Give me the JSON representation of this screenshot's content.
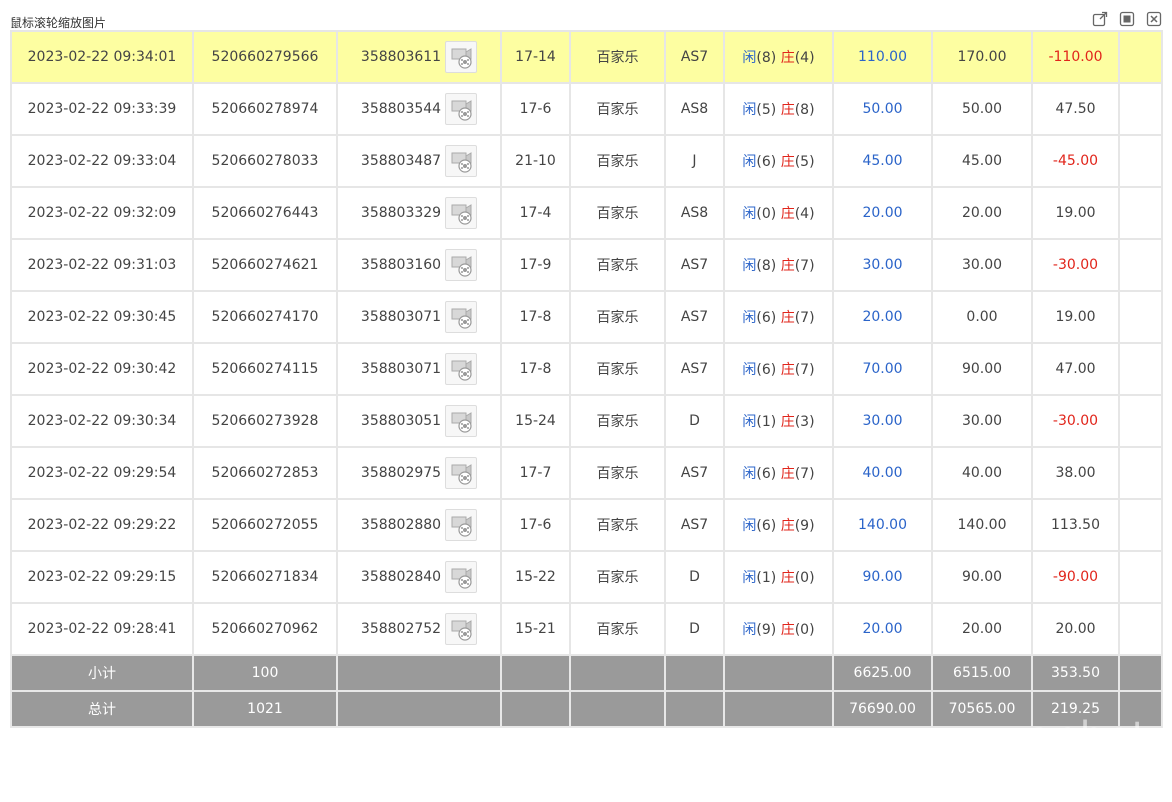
{
  "window": {
    "title": "鼠标滚轮缩放图片",
    "icons": [
      "external-link-icon",
      "maximize-icon",
      "close-icon"
    ]
  },
  "rows": [
    {
      "time": "2023-02-22 09:34:01",
      "order": "520660279566",
      "game": "358803611",
      "table": "17-14",
      "type": "百家乐",
      "dealer": "AS7",
      "player_label": "闲",
      "player": "(8)",
      "banker_label": "庄",
      "banker": "(4)",
      "bet": "110.00",
      "valid": "170.00",
      "result": "-110.00",
      "result_neg": true,
      "highlight": true
    },
    {
      "time": "2023-02-22 09:33:39",
      "order": "520660278974",
      "game": "358803544",
      "table": "17-6",
      "type": "百家乐",
      "dealer": "AS8",
      "player_label": "闲",
      "player": "(5)",
      "banker_label": "庄",
      "banker": "(8)",
      "bet": "50.00",
      "valid": "50.00",
      "result": "47.50",
      "result_neg": false
    },
    {
      "time": "2023-02-22 09:33:04",
      "order": "520660278033",
      "game": "358803487",
      "table": "21-10",
      "type": "百家乐",
      "dealer": "J",
      "player_label": "闲",
      "player": "(6)",
      "banker_label": "庄",
      "banker": "(5)",
      "bet": "45.00",
      "valid": "45.00",
      "result": "-45.00",
      "result_neg": true
    },
    {
      "time": "2023-02-22 09:32:09",
      "order": "520660276443",
      "game": "358803329",
      "table": "17-4",
      "type": "百家乐",
      "dealer": "AS8",
      "player_label": "闲",
      "player": "(0)",
      "banker_label": "庄",
      "banker": "(4)",
      "bet": "20.00",
      "valid": "20.00",
      "result": "19.00",
      "result_neg": false
    },
    {
      "time": "2023-02-22 09:31:03",
      "order": "520660274621",
      "game": "358803160",
      "table": "17-9",
      "type": "百家乐",
      "dealer": "AS7",
      "player_label": "闲",
      "player": "(8)",
      "banker_label": "庄",
      "banker": "(7)",
      "bet": "30.00",
      "valid": "30.00",
      "result": "-30.00",
      "result_neg": true
    },
    {
      "time": "2023-02-22 09:30:45",
      "order": "520660274170",
      "game": "358803071",
      "table": "17-8",
      "type": "百家乐",
      "dealer": "AS7",
      "player_label": "闲",
      "player": "(6)",
      "banker_label": "庄",
      "banker": "(7)",
      "bet": "20.00",
      "valid": "0.00",
      "result": "19.00",
      "result_neg": false
    },
    {
      "time": "2023-02-22 09:30:42",
      "order": "520660274115",
      "game": "358803071",
      "table": "17-8",
      "type": "百家乐",
      "dealer": "AS7",
      "player_label": "闲",
      "player": "(6)",
      "banker_label": "庄",
      "banker": "(7)",
      "bet": "70.00",
      "valid": "90.00",
      "result": "47.00",
      "result_neg": false
    },
    {
      "time": "2023-02-22 09:30:34",
      "order": "520660273928",
      "game": "358803051",
      "table": "15-24",
      "type": "百家乐",
      "dealer": "D",
      "player_label": "闲",
      "player": "(1)",
      "banker_label": "庄",
      "banker": "(3)",
      "bet": "30.00",
      "valid": "30.00",
      "result": "-30.00",
      "result_neg": true
    },
    {
      "time": "2023-02-22 09:29:54",
      "order": "520660272853",
      "game": "358802975",
      "table": "17-7",
      "type": "百家乐",
      "dealer": "AS7",
      "player_label": "闲",
      "player": "(6)",
      "banker_label": "庄",
      "banker": "(7)",
      "bet": "40.00",
      "valid": "40.00",
      "result": "38.00",
      "result_neg": false
    },
    {
      "time": "2023-02-22 09:29:22",
      "order": "520660272055",
      "game": "358802880",
      "table": "17-6",
      "type": "百家乐",
      "dealer": "AS7",
      "player_label": "闲",
      "player": "(6)",
      "banker_label": "庄",
      "banker": "(9)",
      "bet": "140.00",
      "valid": "140.00",
      "result": "113.50",
      "result_neg": false
    },
    {
      "time": "2023-02-22 09:29:15",
      "order": "520660271834",
      "game": "358802840",
      "table": "15-22",
      "type": "百家乐",
      "dealer": "D",
      "player_label": "闲",
      "player": "(1)",
      "banker_label": "庄",
      "banker": "(0)",
      "bet": "90.00",
      "valid": "90.00",
      "result": "-90.00",
      "result_neg": true
    },
    {
      "time": "2023-02-22 09:28:41",
      "order": "520660270962",
      "game": "358802752",
      "table": "15-21",
      "type": "百家乐",
      "dealer": "D",
      "player_label": "闲",
      "player": "(9)",
      "banker_label": "庄",
      "banker": "(0)",
      "bet": "20.00",
      "valid": "20.00",
      "result": "20.00",
      "result_neg": false
    }
  ],
  "subtotal": {
    "label": "小计",
    "count": "100",
    "bet": "6625.00",
    "valid": "6515.00",
    "result": "353.50"
  },
  "total": {
    "label": "总计",
    "count": "1021",
    "bet": "76690.00",
    "valid": "70565.00",
    "result": "219.25"
  },
  "watermark": "wanbet",
  "colors": {
    "highlight": "#fdfea1",
    "blue": "#2b64c9",
    "red": "#e1251b",
    "summary_bg": "#9a9a9a"
  }
}
